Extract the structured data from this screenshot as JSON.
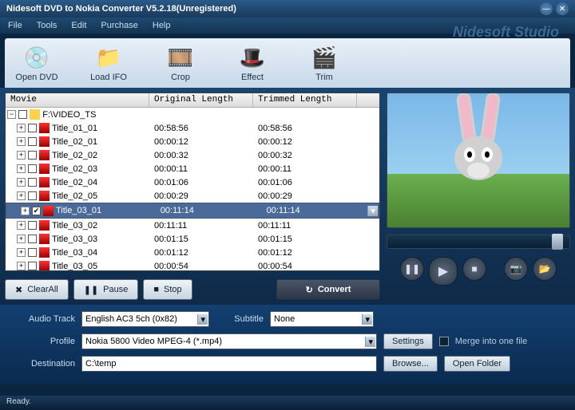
{
  "window": {
    "title": "Nidesoft DVD to Nokia Converter V5.2.18(Unregistered)",
    "brand": "Nidesoft Studio"
  },
  "menu": {
    "file": "File",
    "tools": "Tools",
    "edit": "Edit",
    "purchase": "Purchase",
    "help": "Help"
  },
  "toolbar": {
    "open_dvd": "Open DVD",
    "load_ifo": "Load IFO",
    "crop": "Crop",
    "effect": "Effect",
    "trim": "Trim"
  },
  "list": {
    "headers": {
      "movie": "Movie",
      "orig": "Original Length",
      "trim": "Trimmed Length"
    },
    "group": "F:\\VIDEO_TS",
    "rows": [
      {
        "name": "Title_01_01",
        "orig": "00:58:56",
        "trim": "00:58:56",
        "sel": false,
        "chk": false
      },
      {
        "name": "Title_02_01",
        "orig": "00:00:12",
        "trim": "00:00:12",
        "sel": false,
        "chk": false
      },
      {
        "name": "Title_02_02",
        "orig": "00:00:32",
        "trim": "00:00:32",
        "sel": false,
        "chk": false
      },
      {
        "name": "Title_02_03",
        "orig": "00:00:11",
        "trim": "00:00:11",
        "sel": false,
        "chk": false
      },
      {
        "name": "Title_02_04",
        "orig": "00:01:06",
        "trim": "00:01:06",
        "sel": false,
        "chk": false
      },
      {
        "name": "Title_02_05",
        "orig": "00:00:29",
        "trim": "00:00:29",
        "sel": false,
        "chk": false
      },
      {
        "name": "Title_03_01",
        "orig": "00:11:14",
        "trim": "00:11:14",
        "sel": true,
        "chk": true
      },
      {
        "name": "Title_03_02",
        "orig": "00:11:11",
        "trim": "00:11:11",
        "sel": false,
        "chk": false
      },
      {
        "name": "Title_03_03",
        "orig": "00:01:15",
        "trim": "00:01:15",
        "sel": false,
        "chk": false
      },
      {
        "name": "Title_03_04",
        "orig": "00:01:12",
        "trim": "00:01:12",
        "sel": false,
        "chk": false
      },
      {
        "name": "Title_03_05",
        "orig": "00:00:54",
        "trim": "00:00:54",
        "sel": false,
        "chk": false
      }
    ]
  },
  "actions": {
    "clear": "ClearAll",
    "pause": "Pause",
    "stop": "Stop",
    "convert": "Convert"
  },
  "form": {
    "audio_label": "Audio Track",
    "audio_value": "English AC3 5ch (0x82)",
    "subtitle_label": "Subtitle",
    "subtitle_value": "None",
    "profile_label": "Profile",
    "profile_value": "Nokia 5800 Video MPEG-4 (*.mp4)",
    "settings": "Settings",
    "merge": "Merge into one file",
    "dest_label": "Destination",
    "dest_value": "C:\\temp",
    "browse": "Browse...",
    "open_folder": "Open Folder"
  },
  "status": "Ready."
}
